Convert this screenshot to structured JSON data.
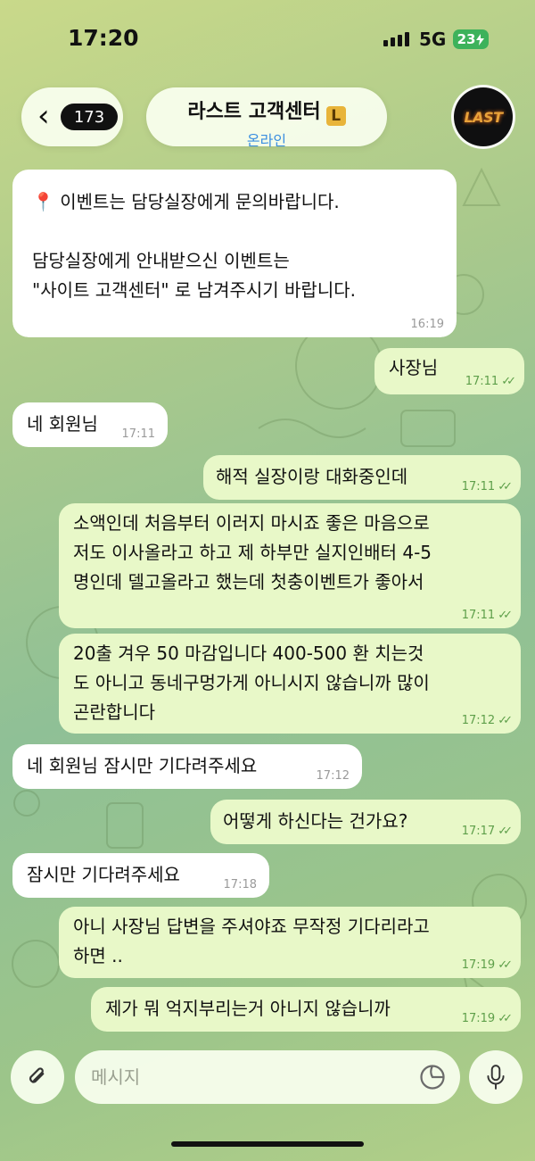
{
  "status": {
    "time": "17:20",
    "network": "5G",
    "battery": "23"
  },
  "header": {
    "back_count": "173",
    "title": "라스트 고객센터",
    "title_emoji": "L",
    "subtitle": "온라인",
    "avatar_text": "LAST"
  },
  "messages": [
    {
      "dir": "in",
      "lines": [
        "📍 이벤트는 담당실장에게 문의바랍니다.",
        "",
        "담당실장에게 안내받으신 이벤트는",
        "\"사이트 고객센터\" 로 남겨주시기 바랍니다."
      ],
      "time": "16:19"
    },
    {
      "dir": "out",
      "lines": [
        "사장님"
      ],
      "time": "17:11",
      "read": true
    },
    {
      "dir": "in",
      "lines": [
        "네 회원님"
      ],
      "time": "17:11"
    },
    {
      "dir": "out",
      "lines": [
        "해적 실장이랑 대화중인데"
      ],
      "time": "17:11",
      "read": true
    },
    {
      "dir": "out",
      "lines": [
        "소액인데 처음부터 이러지 마시죠 좋은 마음으로",
        "저도 이사올라고 하고 제 하부만 실지인배터 4-5",
        "명인데 델고올라고 했는데 첫충이벤트가 좋아서"
      ],
      "time": "17:11",
      "read": true
    },
    {
      "dir": "out",
      "lines": [
        "20출 겨우 50 마감입니다 400-500 환 치는것",
        "도 아니고 동네구멍가게 아니시지 않습니까 많이",
        "곤란합니다"
      ],
      "time": "17:12",
      "read": true
    },
    {
      "dir": "in",
      "lines": [
        "네 회원님 잠시만 기다려주세요"
      ],
      "time": "17:12"
    },
    {
      "dir": "out",
      "lines": [
        "어떻게 하신다는 건가요?"
      ],
      "time": "17:17",
      "read": true
    },
    {
      "dir": "in",
      "lines": [
        "잠시만 기다려주세요"
      ],
      "time": "17:18"
    },
    {
      "dir": "out",
      "lines": [
        "아니 사장님 답변을 주셔야죠 무작정 기다리라고",
        "하면 .."
      ],
      "time": "17:19",
      "read": true
    },
    {
      "dir": "out",
      "lines": [
        "제가 뭐 억지부리는거 아니지 않습니까"
      ],
      "time": "17:19",
      "read": true
    }
  ],
  "composer": {
    "placeholder": "메시지"
  }
}
